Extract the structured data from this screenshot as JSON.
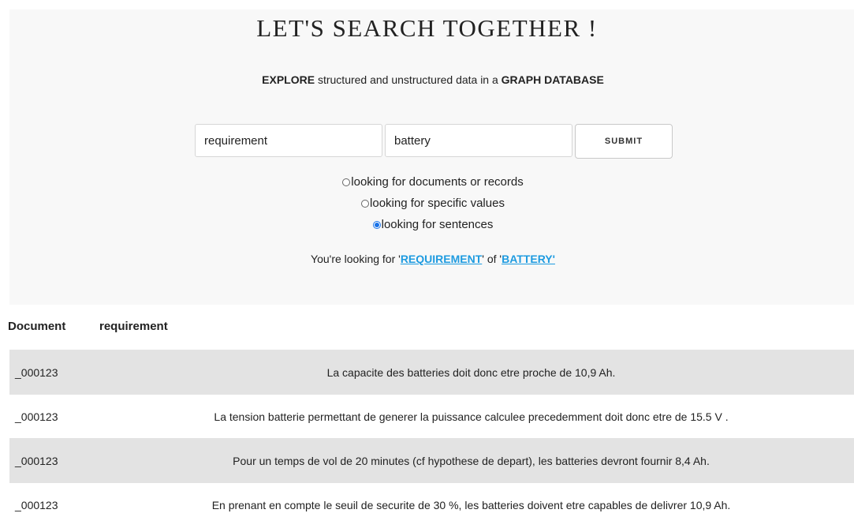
{
  "header": {
    "title": "LET'S SEARCH TOGETHER !",
    "subtitle_explore": "EXPLORE",
    "subtitle_middle": " structured and unstructured data in a ",
    "subtitle_graph": "GRAPH DATABASE"
  },
  "search": {
    "field1_value": "requirement",
    "field2_value": "battery",
    "submit_label": "SUBMIT"
  },
  "options": [
    {
      "label": "looking for documents or records",
      "checked": false
    },
    {
      "label": "looking for specific values",
      "checked": false
    },
    {
      "label": "looking for sentences",
      "checked": true
    }
  ],
  "summary": {
    "prefix": "You're looking for '",
    "term1": "REQUIREMENT",
    "middle": "' of '",
    "term2": "BATTERY'"
  },
  "table": {
    "headers": [
      "Document",
      "requirement"
    ],
    "rows": [
      {
        "document": "_000123",
        "requirement": "La capacite des batteries doit donc etre proche de 10,9 Ah."
      },
      {
        "document": "_000123",
        "requirement": "La tension batterie permettant de generer la puissance calculee precedemment doit donc etre de 15.5 V ."
      },
      {
        "document": "_000123",
        "requirement": "Pour un temps de vol de 20 minutes (cf hypothese de depart), les batteries devront fournir 8,4 Ah."
      },
      {
        "document": "_000123",
        "requirement": "En prenant en compte le seuil de securite de 30 %, les batteries doivent etre capables de delivrer 10,9 Ah."
      }
    ]
  }
}
